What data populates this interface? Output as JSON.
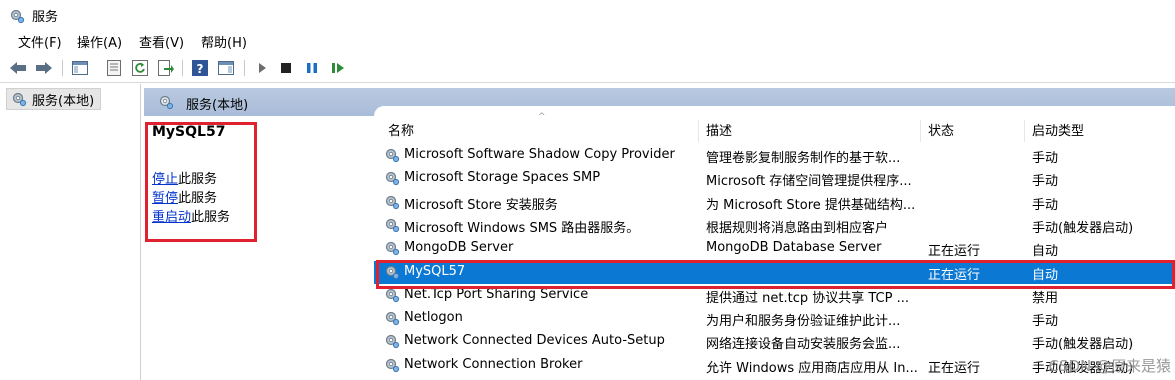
{
  "window": {
    "title": "服务"
  },
  "menu": [
    "文件(F)",
    "操作(A)",
    "查看(V)",
    "帮助(H)"
  ],
  "tree": {
    "root_label": "服务(本地)"
  },
  "panel": {
    "header": "服务(本地)"
  },
  "detail": {
    "service_name": "MySQL57",
    "actions": [
      {
        "link": "停止",
        "rest": "此服务"
      },
      {
        "link": "暂停",
        "rest": "此服务"
      },
      {
        "link": "重启动",
        "rest": "此服务"
      }
    ]
  },
  "columns": {
    "name": "名称",
    "description": "描述",
    "status": "状态",
    "startup": "启动类型"
  },
  "rows": [
    {
      "name": "Microsoft Software Shadow Copy Provider",
      "description": "管理卷影复制服务制作的基于软...",
      "status": "",
      "startup": "手动"
    },
    {
      "name": "Microsoft Storage Spaces SMP",
      "description": "Microsoft 存储空间管理提供程序...",
      "status": "",
      "startup": "手动"
    },
    {
      "name": "Microsoft Store 安装服务",
      "description": "为 Microsoft Store 提供基础结构...",
      "status": "",
      "startup": "手动"
    },
    {
      "name": "Microsoft Windows SMS 路由器服务。",
      "description": "根据规则将消息路由到相应客户",
      "status": "",
      "startup": "手动(触发器启动)"
    },
    {
      "name": "MongoDB Server",
      "description": "MongoDB Database Server",
      "status": "正在运行",
      "startup": "自动"
    },
    {
      "name": "MySQL57",
      "description": "",
      "status": "正在运行",
      "startup": "自动"
    },
    {
      "name": "Net.Tcp Port Sharing Service",
      "description": "提供通过 net.tcp 协议共享 TCP ...",
      "status": "",
      "startup": "禁用"
    },
    {
      "name": "Netlogon",
      "description": "为用户和服务身份验证维护此计...",
      "status": "",
      "startup": "手动"
    },
    {
      "name": "Network Connected Devices Auto-Setup",
      "description": "网络连接设备自动安装服务会监...",
      "status": "",
      "startup": "手动(触发器启动)"
    },
    {
      "name": "Network Connection Broker",
      "description": "允许 Windows 应用商店应用从 In...",
      "status": "正在运行",
      "startup": "手动(触发器启动)"
    }
  ],
  "selected_row": 5,
  "watermark": "CSDN @原来是猿",
  "colors": {
    "selection": "#0b78d4",
    "highlight_box": "#e0212f",
    "link": "#0033cc"
  }
}
